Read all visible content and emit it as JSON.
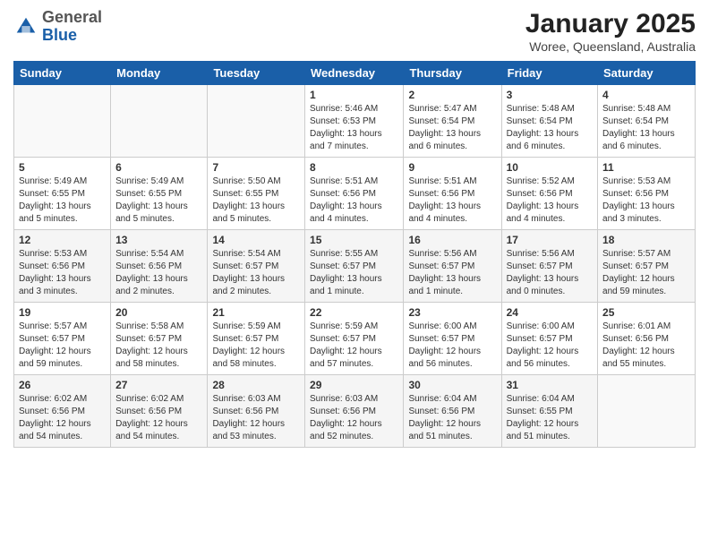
{
  "header": {
    "logo_general": "General",
    "logo_blue": "Blue",
    "month": "January 2025",
    "location": "Woree, Queensland, Australia"
  },
  "days_of_week": [
    "Sunday",
    "Monday",
    "Tuesday",
    "Wednesday",
    "Thursday",
    "Friday",
    "Saturday"
  ],
  "weeks": [
    [
      {
        "day": "",
        "info": ""
      },
      {
        "day": "",
        "info": ""
      },
      {
        "day": "",
        "info": ""
      },
      {
        "day": "1",
        "info": "Sunrise: 5:46 AM\nSunset: 6:53 PM\nDaylight: 13 hours\nand 7 minutes."
      },
      {
        "day": "2",
        "info": "Sunrise: 5:47 AM\nSunset: 6:54 PM\nDaylight: 13 hours\nand 6 minutes."
      },
      {
        "day": "3",
        "info": "Sunrise: 5:48 AM\nSunset: 6:54 PM\nDaylight: 13 hours\nand 6 minutes."
      },
      {
        "day": "4",
        "info": "Sunrise: 5:48 AM\nSunset: 6:54 PM\nDaylight: 13 hours\nand 6 minutes."
      }
    ],
    [
      {
        "day": "5",
        "info": "Sunrise: 5:49 AM\nSunset: 6:55 PM\nDaylight: 13 hours\nand 5 minutes."
      },
      {
        "day": "6",
        "info": "Sunrise: 5:49 AM\nSunset: 6:55 PM\nDaylight: 13 hours\nand 5 minutes."
      },
      {
        "day": "7",
        "info": "Sunrise: 5:50 AM\nSunset: 6:55 PM\nDaylight: 13 hours\nand 5 minutes."
      },
      {
        "day": "8",
        "info": "Sunrise: 5:51 AM\nSunset: 6:56 PM\nDaylight: 13 hours\nand 4 minutes."
      },
      {
        "day": "9",
        "info": "Sunrise: 5:51 AM\nSunset: 6:56 PM\nDaylight: 13 hours\nand 4 minutes."
      },
      {
        "day": "10",
        "info": "Sunrise: 5:52 AM\nSunset: 6:56 PM\nDaylight: 13 hours\nand 4 minutes."
      },
      {
        "day": "11",
        "info": "Sunrise: 5:53 AM\nSunset: 6:56 PM\nDaylight: 13 hours\nand 3 minutes."
      }
    ],
    [
      {
        "day": "12",
        "info": "Sunrise: 5:53 AM\nSunset: 6:56 PM\nDaylight: 13 hours\nand 3 minutes."
      },
      {
        "day": "13",
        "info": "Sunrise: 5:54 AM\nSunset: 6:56 PM\nDaylight: 13 hours\nand 2 minutes."
      },
      {
        "day": "14",
        "info": "Sunrise: 5:54 AM\nSunset: 6:57 PM\nDaylight: 13 hours\nand 2 minutes."
      },
      {
        "day": "15",
        "info": "Sunrise: 5:55 AM\nSunset: 6:57 PM\nDaylight: 13 hours\nand 1 minute."
      },
      {
        "day": "16",
        "info": "Sunrise: 5:56 AM\nSunset: 6:57 PM\nDaylight: 13 hours\nand 1 minute."
      },
      {
        "day": "17",
        "info": "Sunrise: 5:56 AM\nSunset: 6:57 PM\nDaylight: 13 hours\nand 0 minutes."
      },
      {
        "day": "18",
        "info": "Sunrise: 5:57 AM\nSunset: 6:57 PM\nDaylight: 12 hours\nand 59 minutes."
      }
    ],
    [
      {
        "day": "19",
        "info": "Sunrise: 5:57 AM\nSunset: 6:57 PM\nDaylight: 12 hours\nand 59 minutes."
      },
      {
        "day": "20",
        "info": "Sunrise: 5:58 AM\nSunset: 6:57 PM\nDaylight: 12 hours\nand 58 minutes."
      },
      {
        "day": "21",
        "info": "Sunrise: 5:59 AM\nSunset: 6:57 PM\nDaylight: 12 hours\nand 58 minutes."
      },
      {
        "day": "22",
        "info": "Sunrise: 5:59 AM\nSunset: 6:57 PM\nDaylight: 12 hours\nand 57 minutes."
      },
      {
        "day": "23",
        "info": "Sunrise: 6:00 AM\nSunset: 6:57 PM\nDaylight: 12 hours\nand 56 minutes."
      },
      {
        "day": "24",
        "info": "Sunrise: 6:00 AM\nSunset: 6:57 PM\nDaylight: 12 hours\nand 56 minutes."
      },
      {
        "day": "25",
        "info": "Sunrise: 6:01 AM\nSunset: 6:56 PM\nDaylight: 12 hours\nand 55 minutes."
      }
    ],
    [
      {
        "day": "26",
        "info": "Sunrise: 6:02 AM\nSunset: 6:56 PM\nDaylight: 12 hours\nand 54 minutes."
      },
      {
        "day": "27",
        "info": "Sunrise: 6:02 AM\nSunset: 6:56 PM\nDaylight: 12 hours\nand 54 minutes."
      },
      {
        "day": "28",
        "info": "Sunrise: 6:03 AM\nSunset: 6:56 PM\nDaylight: 12 hours\nand 53 minutes."
      },
      {
        "day": "29",
        "info": "Sunrise: 6:03 AM\nSunset: 6:56 PM\nDaylight: 12 hours\nand 52 minutes."
      },
      {
        "day": "30",
        "info": "Sunrise: 6:04 AM\nSunset: 6:56 PM\nDaylight: 12 hours\nand 51 minutes."
      },
      {
        "day": "31",
        "info": "Sunrise: 6:04 AM\nSunset: 6:55 PM\nDaylight: 12 hours\nand 51 minutes."
      },
      {
        "day": "",
        "info": ""
      }
    ]
  ]
}
